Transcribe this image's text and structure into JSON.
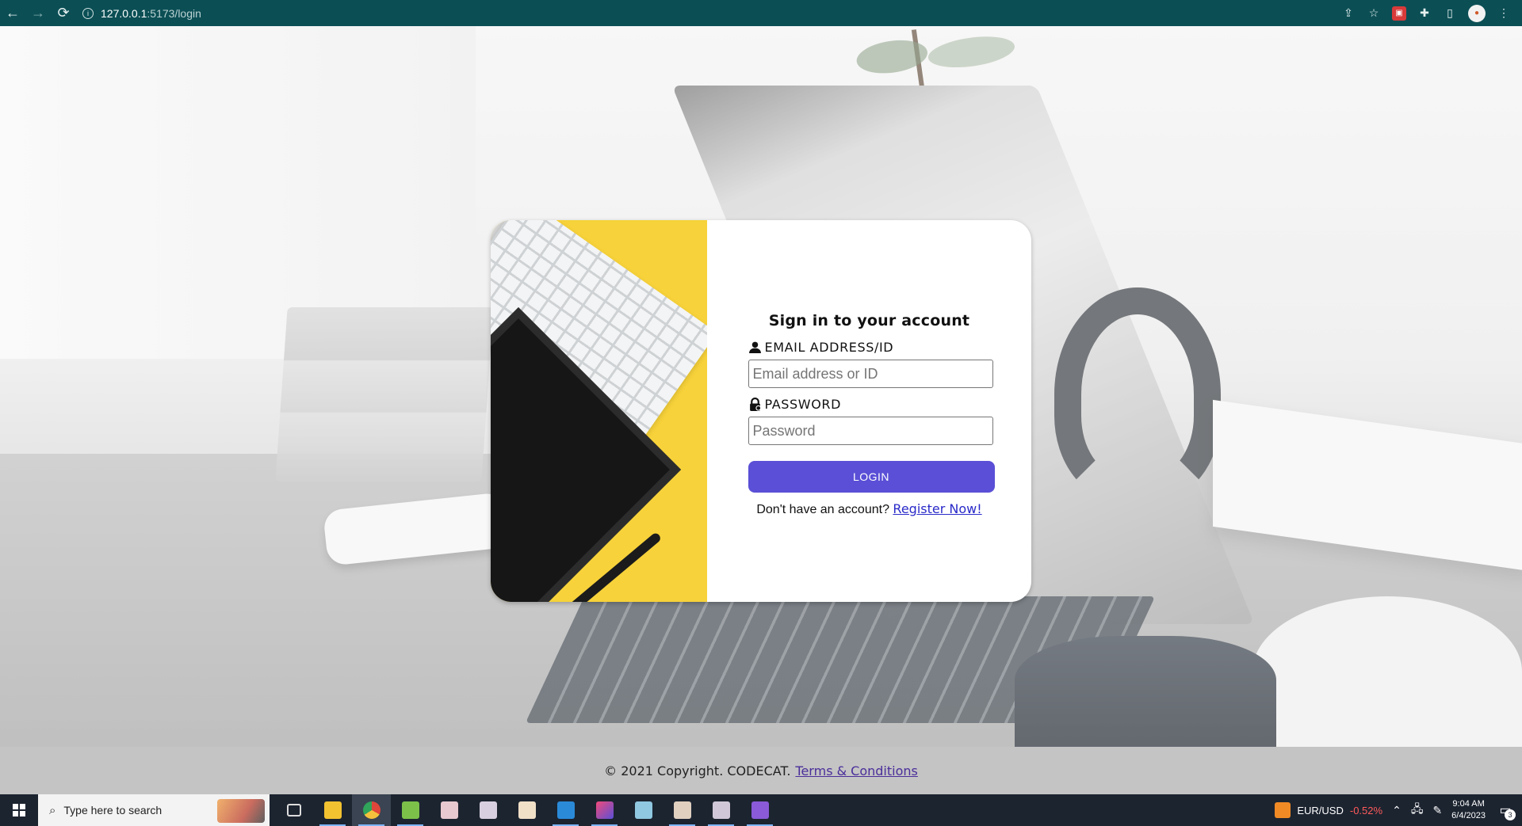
{
  "browser": {
    "url_host": "127.0.0.1",
    "url_path": ":5173/login"
  },
  "login": {
    "title": "Sign in to your account",
    "email_label": "EMAIL ADDRESS/ID",
    "email_placeholder": "Email address or ID",
    "email_value": "",
    "password_label": "PASSWORD",
    "password_placeholder": "Password",
    "password_value": "",
    "login_button": "LOGIN",
    "register_prompt": "Don't have an account?",
    "register_link": "Register Now!",
    "accent_color": "#5a4fd6"
  },
  "footer": {
    "copyright": "© 2021 Copyright. CODECAT.",
    "terms_link": "Terms & Conditions"
  },
  "taskbar": {
    "search_placeholder": "Type here to search",
    "apps": [
      {
        "icon": "task-view-icon"
      },
      {
        "icon": "file-explorer-icon"
      },
      {
        "icon": "chrome-icon"
      },
      {
        "icon": "notepad-icon"
      },
      {
        "icon": "anime-app-icon"
      },
      {
        "icon": "anime-app-icon"
      },
      {
        "icon": "anime-app-icon"
      },
      {
        "icon": "vscode-icon"
      },
      {
        "icon": "intellij-icon"
      },
      {
        "icon": "app-icon"
      },
      {
        "icon": "anime-app-icon"
      },
      {
        "icon": "anime-app-icon"
      },
      {
        "icon": "visual-studio-icon"
      }
    ],
    "fx_pair": "EUR/USD",
    "fx_change": "-0.52%",
    "time": "9:04 AM",
    "date": "6/4/2023",
    "notification_count": "3"
  }
}
